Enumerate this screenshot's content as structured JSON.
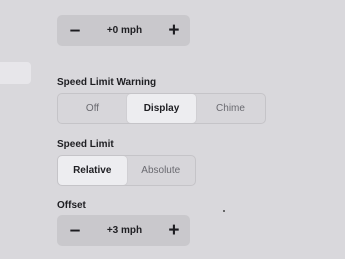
{
  "top_stepper": {
    "minus": "–",
    "value": "+0 mph",
    "plus": "+"
  },
  "speed_limit_warning": {
    "label": "Speed Limit Warning",
    "options": [
      "Off",
      "Display",
      "Chime"
    ],
    "selected": "Display"
  },
  "speed_limit": {
    "label": "Speed Limit",
    "options": [
      "Relative",
      "Absolute"
    ],
    "selected": "Relative"
  },
  "offset": {
    "label": "Offset",
    "minus": "–",
    "value": "+3 mph",
    "plus": "+"
  }
}
